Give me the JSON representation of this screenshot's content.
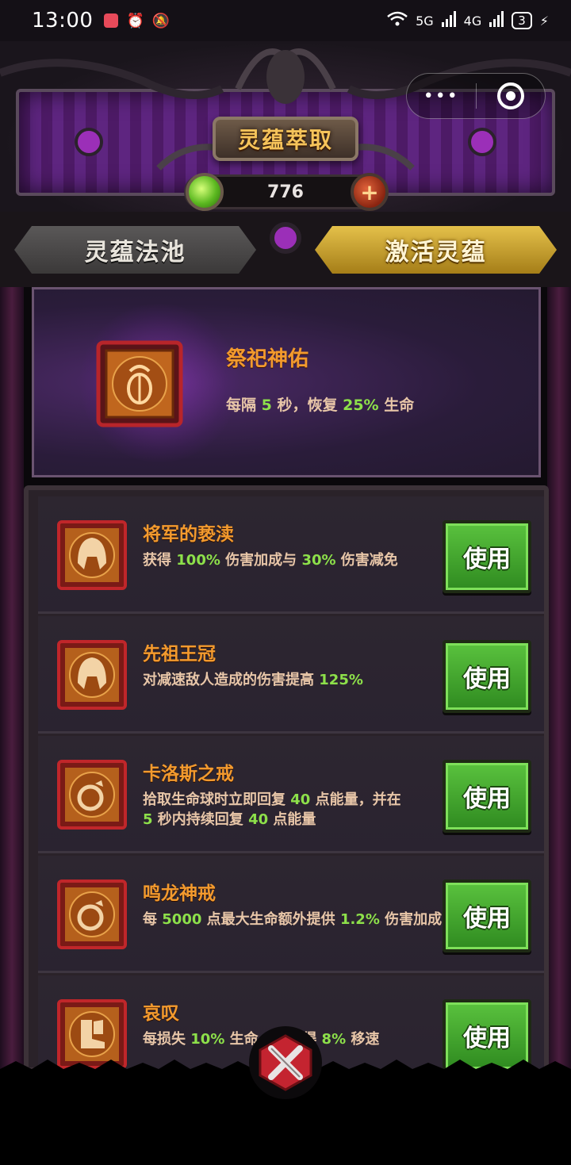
{
  "status_bar": {
    "time": "13:00",
    "network_labels": [
      "5G",
      "4G"
    ],
    "battery": "3"
  },
  "header": {
    "title": "灵蕴萃取",
    "currency_value": "776",
    "plus_label": "+",
    "capsule_menu": "•••"
  },
  "tabs": [
    {
      "label": "灵蕴法池",
      "active": false
    },
    {
      "label": "激活灵蕴",
      "active": true
    }
  ],
  "featured": {
    "name": "祭祀神佑",
    "desc_parts": [
      "每隔 ",
      "5",
      " 秒，恢复 ",
      "25%",
      " 生命"
    ],
    "icon": "scarab-amulet-icon"
  },
  "items": [
    {
      "name": "将军的亵渎",
      "icon": "spartan-helmet-icon",
      "desc_parts": [
        "获得 ",
        "100%",
        " 伤害加成与 ",
        "30%",
        " 伤害减免"
      ],
      "button": "使用"
    },
    {
      "name": "先祖王冠",
      "icon": "spartan-helmet-icon",
      "desc_parts": [
        "对减速敌人造成的伤害提高 ",
        "125%"
      ],
      "button": "使用"
    },
    {
      "name": "卡洛斯之戒",
      "icon": "ring-icon",
      "desc_parts": [
        "拾取生命球时立即回复 ",
        "40",
        " 点能量，并在",
        "5",
        " 秒内持续回复 ",
        "40",
        " 点能量"
      ],
      "button": "使用"
    },
    {
      "name": "鸣龙神戒",
      "icon": "ring-icon",
      "desc_parts": [
        "每 ",
        "5000",
        " 点最大生命额外提供 ",
        "1.2%",
        " 伤害加成"
      ],
      "button": "使用"
    },
    {
      "name": "哀叹",
      "icon": "boot-icon",
      "desc_parts": [
        "每损失 ",
        "10%",
        " 生命",
        "获得 ",
        "8%",
        " 移速"
      ],
      "button": "使用"
    }
  ],
  "colors": {
    "name_orange": "#f29a2e",
    "highlight_green": "#8de04a",
    "desc_tan": "#e8c6a8",
    "button_green": "#3fa52c",
    "tab_gold": "#d2ac36"
  }
}
